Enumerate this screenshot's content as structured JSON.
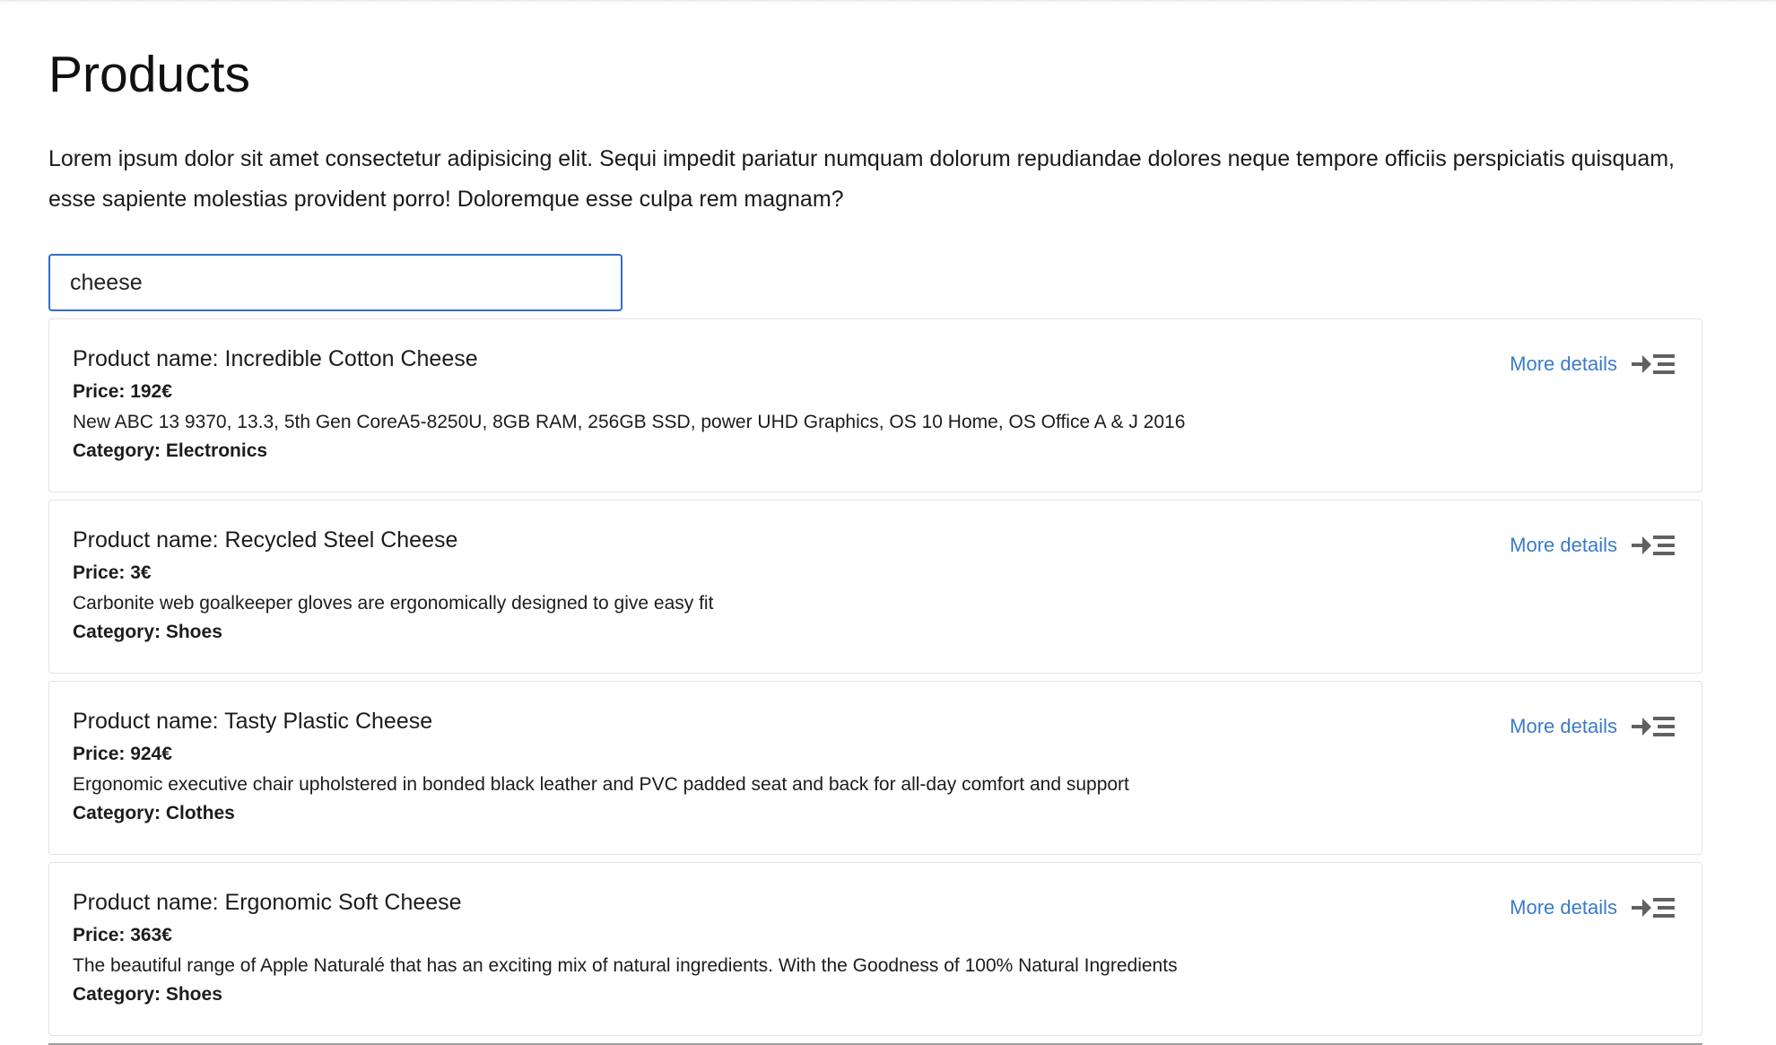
{
  "page": {
    "title": "Products",
    "intro": "Lorem ipsum dolor sit amet consectetur adipisicing elit. Sequi impedit pariatur numquam dolorum repudiandae dolores neque tempore officiis perspiciatis quisquam, esse sapiente molestias provident porro! Doloremque esse culpa rem magnam?"
  },
  "search": {
    "value": "cheese",
    "placeholder": ""
  },
  "products": [
    {
      "name": "Product name: Incredible Cotton Cheese",
      "price": "Price: 192€",
      "description": "New ABC 13 9370, 13.3, 5th Gen CoreA5-8250U, 8GB RAM, 256GB SSD, power UHD Graphics, OS 10 Home, OS Office A & J 2016",
      "category": "Category: Electronics",
      "more_details": "More details"
    },
    {
      "name": "Product name: Recycled Steel Cheese",
      "price": "Price: 3€",
      "description": "Carbonite web goalkeeper gloves are ergonomically designed to give easy fit",
      "category": "Category: Shoes",
      "more_details": "More details"
    },
    {
      "name": "Product name: Tasty Plastic Cheese",
      "price": "Price: 924€",
      "description": "Ergonomic executive chair upholstered in bonded black leather and PVC padded seat and back for all-day comfort and support",
      "category": "Category: Clothes",
      "more_details": "More details"
    },
    {
      "name": "Product name: Ergonomic Soft Cheese",
      "price": "Price: 363€",
      "description": "The beautiful range of Apple Naturalé that has an exciting mix of natural ingredients. With the Goodness of 100% Natural Ingredients",
      "category": "Category: Shoes",
      "more_details": "More details"
    }
  ],
  "icons": {
    "details": "arrow-to-list-icon"
  },
  "colors": {
    "accent": "#3a7bc8",
    "search_border": "#2f6fc6",
    "icon": "#616161"
  }
}
